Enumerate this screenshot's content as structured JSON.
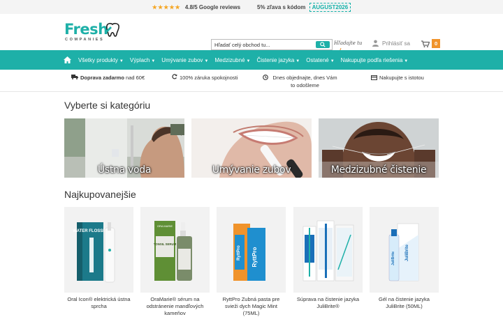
{
  "topbar": {
    "stars": "★★★★★",
    "rating": "4.8/5 Google reviews",
    "promo_text": "5% zľava s kódom",
    "promo_code": "AUGUST2026"
  },
  "header": {
    "logo_main": "Fresh",
    "logo_sub": "COMPANIES",
    "search_placeholder": "Hľadať celý obchod tu...",
    "search_hint": "Hľadajte tu",
    "login_label": "Prihlásiť sa",
    "cart_count": "0"
  },
  "nav": {
    "items": [
      "Všetky produkty",
      "Výplach",
      "Umývanie zubov",
      "Medzizubné",
      "Čistenie jazyka",
      "Ostatené",
      "Nakupujte podľa riešenia"
    ]
  },
  "benefits": [
    {
      "bold": "Doprava zadarmo",
      "text": " nad 60€"
    },
    {
      "bold": "",
      "text": "100% záruka spokojnosti"
    },
    {
      "bold": "",
      "text": "Dnes objednajte, dnes Vám to odošleme"
    },
    {
      "bold": "",
      "text": "Nakupujte s istotou"
    }
  ],
  "categories": {
    "title": "Vyberte si kategóriu",
    "items": [
      "Ústna voda",
      "Umývanie zubov",
      "Medzizubné čistenie"
    ]
  },
  "bestsellers": {
    "title": "Najkupovanejšie",
    "products": [
      {
        "name": "Oral Icon® elektrická ústna sprcha",
        "box_text": "WATER FLOSSER",
        "brand": "oral icon"
      },
      {
        "name": "OraMarie® sérum na odstránenie mandľových kameňov",
        "box_text": "TONSIL SERUM",
        "brand": "ORA MARIE"
      },
      {
        "name": "RyttPro Zubná pasta pre svieži dych Magic Mint (75ML)",
        "box_text": "RyttPro",
        "brand": "RyttPro"
      },
      {
        "name": "Súprava na čistenie jazyka JuliBrite®",
        "box_text": "",
        "brand": ""
      },
      {
        "name": "Gél na čistenie jazyka JuliBrite (50ML)",
        "box_text": "JuliBrite",
        "brand": "JuliBrite"
      }
    ]
  },
  "colors": {
    "accent": "#1eb0a8",
    "cart_badge": "#f0932b",
    "stars": "#f5a623"
  }
}
